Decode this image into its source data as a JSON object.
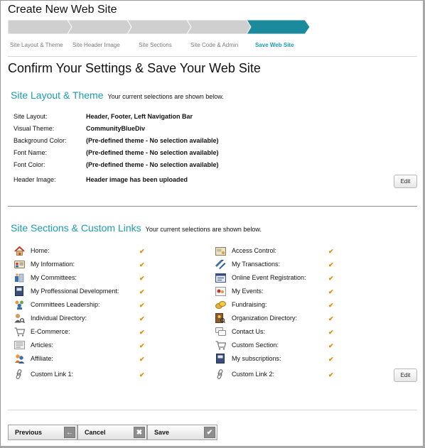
{
  "page_title": "Create New Web Site",
  "wizard": {
    "steps": [
      "Site Layout & Theme",
      "Site Header Image",
      "Site Sections",
      "Site Code & Admin",
      "Save Web Site"
    ],
    "active_index": 4,
    "colors": {
      "inactive": "#cfcfcf",
      "active": "#1b8a9c"
    }
  },
  "heading": "Confirm Your Settings & Save Your Web Site",
  "layout_section": {
    "title": "Site Layout & Theme",
    "note": "Your current selections are shown below.",
    "rows": [
      {
        "key": "Site Layout:",
        "value": "Header, Footer, Left Navigation Bar"
      },
      {
        "key": "Visual Theme:",
        "value": "CommunityBlueDiv"
      },
      {
        "key": "Background Color:",
        "value": "(Pre-defined theme - No selection available)"
      },
      {
        "key": "Font Name:",
        "value": "(Pre-defined theme - No selection available)"
      },
      {
        "key": "Font Color:",
        "value": "(Pre-defined theme - No selection available)"
      },
      {
        "key": "Header Image:",
        "value": "Header image has been uploaded"
      }
    ],
    "edit_label": "Edit"
  },
  "sections_section": {
    "title": "Site Sections & Custom Links",
    "note": "Your current selections are shown below.",
    "check": "✔",
    "left": [
      {
        "label": "Home:",
        "icon": "home-icon"
      },
      {
        "label": "My Information:",
        "icon": "id-card-icon"
      },
      {
        "label": "My Committees:",
        "icon": "committees-icon"
      },
      {
        "label": "My Proffessional Development:",
        "icon": "book-icon"
      },
      {
        "label": "Committees Leadership:",
        "icon": "group-icon"
      },
      {
        "label": "Individual Directory:",
        "icon": "person-search-icon"
      },
      {
        "label": "E-Commerce:",
        "icon": "cart-icon"
      },
      {
        "label": "Articles:",
        "icon": "document-icon"
      },
      {
        "label": "Affiliate:",
        "icon": "people-icon"
      },
      {
        "label": "Custom Link 1:",
        "icon": "link-icon"
      }
    ],
    "right": [
      {
        "label": "Access Control:",
        "icon": "access-control-icon"
      },
      {
        "label": "My Transactions:",
        "icon": "transactions-icon"
      },
      {
        "label": "Online Event Registration:",
        "icon": "registration-icon"
      },
      {
        "label": "My Events:",
        "icon": "events-icon"
      },
      {
        "label": "Fundraising:",
        "icon": "coins-icon"
      },
      {
        "label": "Organization Directory:",
        "icon": "organization-icon"
      },
      {
        "label": "Contact Us:",
        "icon": "chat-icon"
      },
      {
        "label": "Custom Section:",
        "icon": "cart-icon"
      },
      {
        "label": "My subscriptions:",
        "icon": "book-icon"
      },
      {
        "label": "Custom Link 2:",
        "icon": "link-icon"
      }
    ],
    "edit_label": "Edit"
  },
  "footer": {
    "previous_label": "Previous",
    "previous_icon": "←",
    "cancel_label": "Cancel",
    "cancel_icon": "✖",
    "save_label": "Save",
    "save_icon": "✔"
  }
}
